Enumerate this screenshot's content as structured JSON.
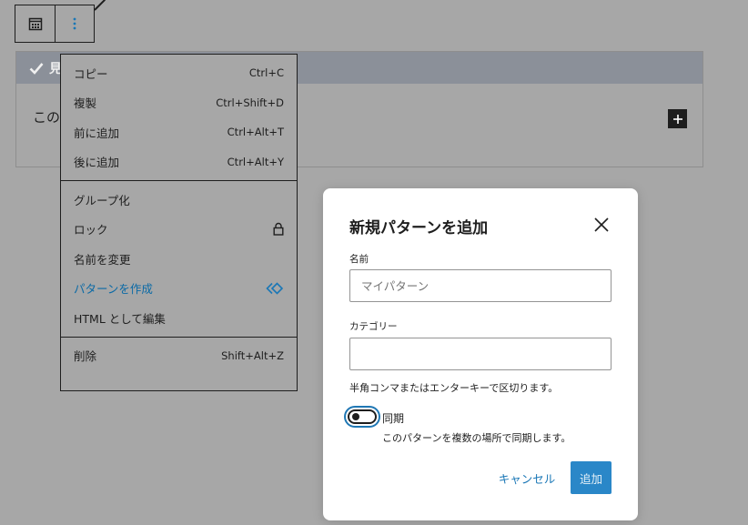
{
  "block": {
    "header_label": "見",
    "body_text": "この"
  },
  "menu": {
    "groups": [
      [
        {
          "label": "コピー",
          "shortcut": "Ctrl+C"
        },
        {
          "label": "複製",
          "shortcut": "Ctrl+Shift+D"
        },
        {
          "label": "前に追加",
          "shortcut": "Ctrl+Alt+T"
        },
        {
          "label": "後に追加",
          "shortcut": "Ctrl+Alt+Y"
        }
      ],
      [
        {
          "label": "グループ化",
          "shortcut": ""
        },
        {
          "label": "ロック",
          "shortcut": "",
          "icon": "lock-icon"
        },
        {
          "label": "名前を変更",
          "shortcut": ""
        },
        {
          "label": "パターンを作成",
          "shortcut": "",
          "icon": "pattern-symbol-icon"
        },
        {
          "label": "HTML として編集",
          "shortcut": ""
        }
      ],
      [
        {
          "label": "削除",
          "shortcut": "Shift+Alt+Z"
        }
      ]
    ]
  },
  "modal": {
    "title": "新規パターンを追加",
    "name_label": "名前",
    "name_placeholder": "マイパターン",
    "name_value": "",
    "category_label": "カテゴリー",
    "category_value": "",
    "category_help": "半角コンマまたはエンターキーで区切ります。",
    "sync_label": "同期",
    "sync_help": "このパターンを複数の場所で同期します。",
    "sync_enabled": false,
    "cancel_label": "キャンセル",
    "add_label": "追加"
  },
  "colors": {
    "overlay": "#a7a7a7",
    "accent": "#2a87c8",
    "link": "#1a77b6"
  }
}
